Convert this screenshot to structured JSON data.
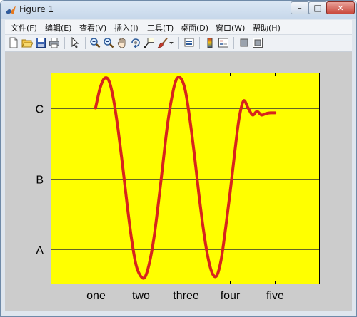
{
  "window": {
    "title": "Figure 1",
    "minimize_glyph": "–",
    "maximize_glyph": "□",
    "close_glyph": "✕"
  },
  "menubar": {
    "items": [
      {
        "label": "文件(F)"
      },
      {
        "label": "编辑(E)"
      },
      {
        "label": "查看(V)"
      },
      {
        "label": "插入(I)"
      },
      {
        "label": "工具(T)"
      },
      {
        "label": "桌面(D)"
      },
      {
        "label": "窗口(W)"
      },
      {
        "label": "帮助(H)"
      }
    ]
  },
  "toolbar": {
    "icons": [
      "new-figure-icon",
      "open-file-icon",
      "save-icon",
      "print-icon",
      "edit-plot-pointer-icon",
      "zoom-in-icon",
      "zoom-out-icon",
      "pan-hand-icon",
      "rotate-3d-icon",
      "data-cursor-icon",
      "brush-icon",
      "brush-dropdown-icon",
      "link-plot-icon",
      "colorbar-icon",
      "legend-icon",
      "hide-plot-tools-icon",
      "show-plot-tools-icon"
    ]
  },
  "colors": {
    "axes_background": "#ffff00",
    "line": "#d7241d",
    "figure_background": "#cccccc"
  },
  "chart_data": {
    "type": "line",
    "title": "",
    "xlabel": "",
    "ylabel": "",
    "xlim": [
      0,
      6
    ],
    "ylim": [
      0.5,
      3.5
    ],
    "x_ticks": [
      1,
      2,
      3,
      4,
      5
    ],
    "x_tick_labels": [
      "one",
      "two",
      "three",
      "four",
      "five"
    ],
    "y_ticks": [
      1,
      2,
      3
    ],
    "y_tick_labels": [
      "A",
      "B",
      "C"
    ],
    "grid": "horizontal",
    "series": [
      {
        "x": [
          1.0,
          1.1,
          1.2,
          1.3,
          1.4,
          1.5,
          1.6,
          1.7,
          1.8,
          1.9,
          2.0,
          2.1,
          2.2,
          2.3,
          2.4,
          2.5,
          2.6,
          2.7,
          2.8,
          2.9,
          3.0,
          3.1,
          3.2,
          3.3,
          3.4,
          3.5,
          3.6,
          3.7,
          3.8,
          3.9,
          4.0,
          4.1,
          4.2,
          4.3,
          4.4,
          4.5,
          4.6,
          4.7,
          4.8,
          4.9,
          5.0
        ],
        "y": [
          3.0,
          3.28,
          3.42,
          3.38,
          3.12,
          2.7,
          2.2,
          1.65,
          1.15,
          0.78,
          0.62,
          0.6,
          0.8,
          1.15,
          1.65,
          2.2,
          2.75,
          3.15,
          3.4,
          3.42,
          3.25,
          2.85,
          2.35,
          1.8,
          1.3,
          0.9,
          0.66,
          0.62,
          0.85,
          1.3,
          1.8,
          2.35,
          2.85,
          3.1,
          3.0,
          2.9,
          2.95,
          2.9,
          2.92,
          2.93,
          2.93
        ]
      }
    ]
  }
}
